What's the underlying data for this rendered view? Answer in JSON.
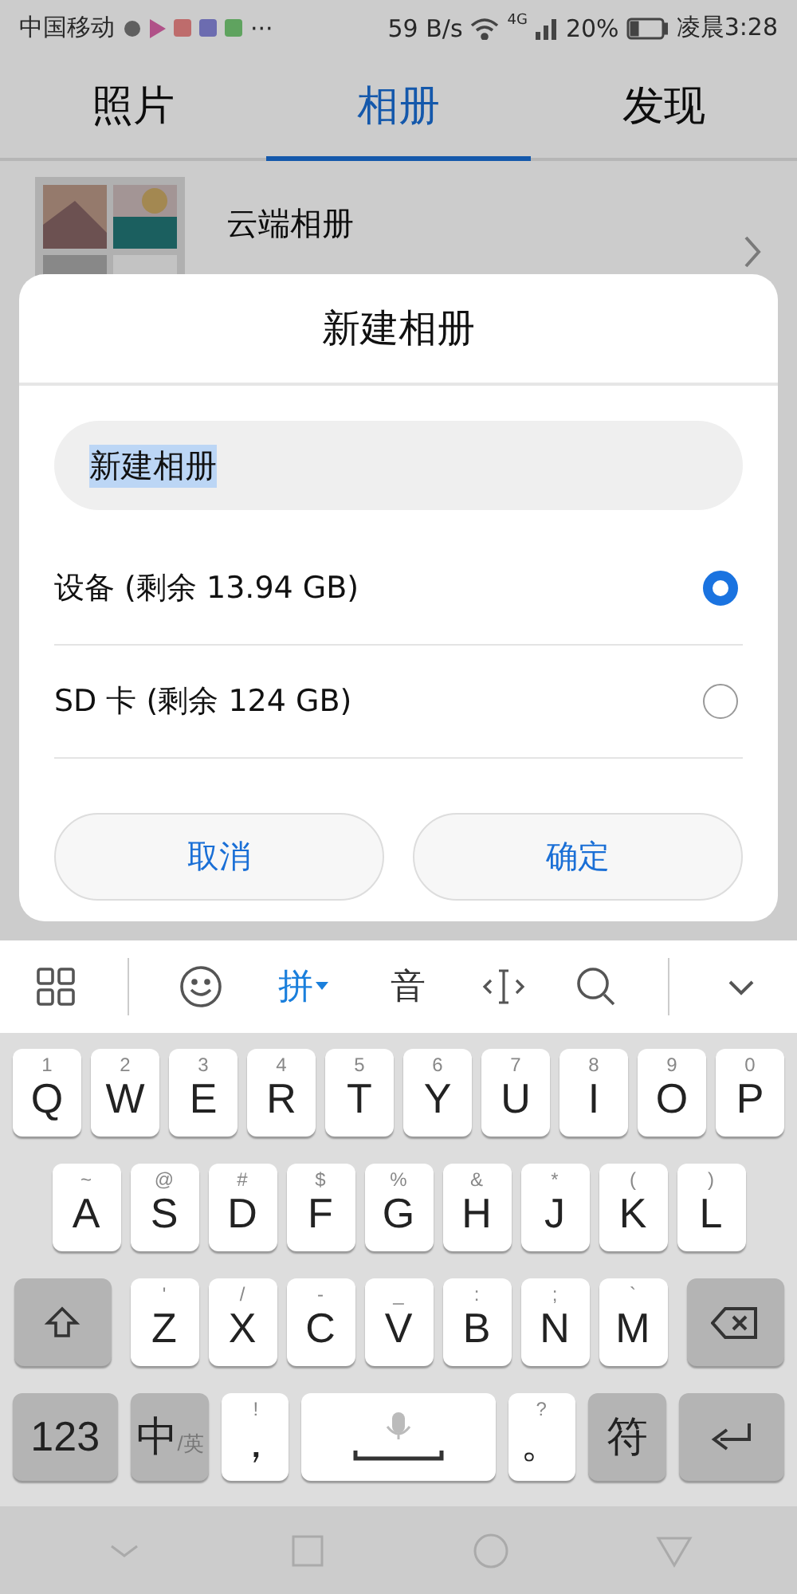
{
  "status_bar": {
    "carrier": "中国移动",
    "more": "···",
    "speed": "59 B/s",
    "signal_tag": "4G",
    "battery": "20%",
    "time": "凌晨3:28"
  },
  "tabs": [
    {
      "label": "照片",
      "selected": false
    },
    {
      "label": "相册",
      "selected": true
    },
    {
      "label": "发现",
      "selected": false
    }
  ],
  "albums": [
    {
      "title": "云端相册"
    }
  ],
  "dialog": {
    "title": "新建相册",
    "name_field": {
      "value": "新建相册",
      "highlighted": true
    },
    "options": [
      {
        "label": "设备 (剩余 13.94 GB)",
        "selected": true
      },
      {
        "label": "SD 卡 (剩余 124 GB)",
        "selected": false
      }
    ],
    "buttons": [
      "取消",
      "确定"
    ]
  },
  "keyboard_toolbar": [
    {
      "kind": "grid"
    },
    {
      "kind": "divider"
    },
    {
      "kind": "emoji"
    },
    {
      "kind": "text",
      "label": "拼",
      "selected": true
    },
    {
      "kind": "text",
      "label": "音",
      "selected": false
    },
    {
      "kind": "cursor"
    },
    {
      "kind": "search"
    },
    {
      "kind": "divider"
    },
    {
      "kind": "collapse"
    }
  ],
  "keyboard_rows": [
    [
      {
        "label": "Q",
        "hint": "1"
      },
      {
        "label": "W",
        "hint": "2"
      },
      {
        "label": "E",
        "hint": "3"
      },
      {
        "label": "R",
        "hint": "4"
      },
      {
        "label": "T",
        "hint": "5"
      },
      {
        "label": "Y",
        "hint": "6"
      },
      {
        "label": "U",
        "hint": "7"
      },
      {
        "label": "I",
        "hint": "8"
      },
      {
        "label": "O",
        "hint": "9"
      },
      {
        "label": "P",
        "hint": "0"
      }
    ],
    [
      {
        "label": "A",
        "hint": "~"
      },
      {
        "label": "S",
        "hint": "@"
      },
      {
        "label": "D",
        "hint": "#"
      },
      {
        "label": "F",
        "hint": "$"
      },
      {
        "label": "G",
        "hint": "%"
      },
      {
        "label": "H",
        "hint": "&"
      },
      {
        "label": "J",
        "hint": "*"
      },
      {
        "label": "K",
        "hint": "("
      },
      {
        "label": "L",
        "hint": ")"
      }
    ],
    [
      {
        "kind": "shift"
      },
      {
        "label": "Z",
        "hint": "'"
      },
      {
        "label": "X",
        "hint": "/"
      },
      {
        "label": "C",
        "hint": "-"
      },
      {
        "label": "V",
        "hint": "_"
      },
      {
        "label": "B",
        "hint": ":"
      },
      {
        "label": "N",
        "hint": ";"
      },
      {
        "label": "M",
        "hint": "`"
      },
      {
        "kind": "delete"
      }
    ],
    [
      {
        "kind": "func",
        "label": "123"
      },
      {
        "kind": "lang",
        "label": "中",
        "hint": "/英"
      },
      {
        "label": "，",
        "hint": "!"
      },
      {
        "kind": "space"
      },
      {
        "label": "。",
        "hint": "?"
      },
      {
        "kind": "func",
        "label": "符"
      },
      {
        "kind": "enter"
      }
    ]
  ]
}
